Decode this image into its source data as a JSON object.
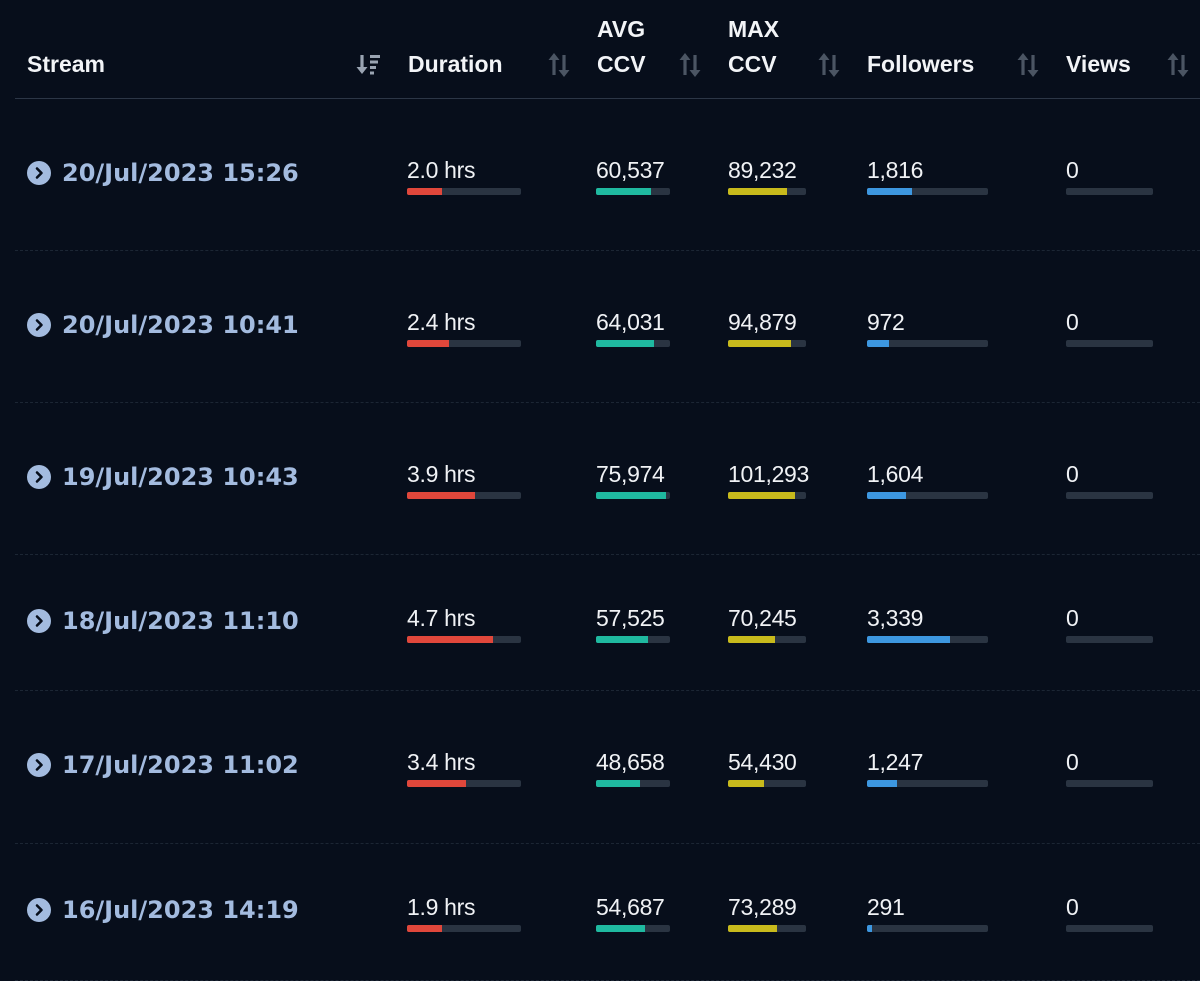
{
  "columns": [
    {
      "label": "Stream",
      "sort_icon": "sort-desc-active-icon"
    },
    {
      "label": "Duration",
      "sort_icon": "sort-icon"
    },
    {
      "label": "AVG\nCCV",
      "sort_icon": "sort-icon"
    },
    {
      "label": "MAX\nCCV",
      "sort_icon": "sort-icon"
    },
    {
      "label": "Followers",
      "sort_icon": "sort-icon"
    },
    {
      "label": "Views",
      "sort_icon": "sort-icon"
    }
  ],
  "colors": {
    "duration": "#e0473b",
    "avg_ccv": "#1fb9a0",
    "max_ccv": "#c8ba1c",
    "followers": "#3d97e0",
    "link": "#a3bbdf",
    "bar_track": "#2a3442"
  },
  "rows": [
    {
      "stream": "20/Jul/2023 15:26",
      "duration": "2.0 hrs",
      "duration_fill": 0.31,
      "avg_ccv": "60,537",
      "avg_ccv_fill": 0.74,
      "max_ccv": "89,232",
      "max_ccv_fill": 0.76,
      "followers": "1,816",
      "followers_fill": 0.37,
      "views": "0",
      "views_fill": 0
    },
    {
      "stream": "20/Jul/2023 10:41",
      "duration": "2.4 hrs",
      "duration_fill": 0.37,
      "avg_ccv": "64,031",
      "avg_ccv_fill": 0.78,
      "max_ccv": "94,879",
      "max_ccv_fill": 0.81,
      "followers": "972",
      "followers_fill": 0.18,
      "views": "0",
      "views_fill": 0
    },
    {
      "stream": "19/Jul/2023 10:43",
      "duration": "3.9 hrs",
      "duration_fill": 0.6,
      "avg_ccv": "75,974",
      "avg_ccv_fill": 0.94,
      "max_ccv": "101,293",
      "max_ccv_fill": 0.86,
      "followers": "1,604",
      "followers_fill": 0.32,
      "views": "0",
      "views_fill": 0
    },
    {
      "stream": "18/Jul/2023 11:10",
      "duration": "4.7 hrs",
      "duration_fill": 0.75,
      "avg_ccv": "57,525",
      "avg_ccv_fill": 0.7,
      "max_ccv": "70,245",
      "max_ccv_fill": 0.6,
      "followers": "3,339",
      "followers_fill": 0.69,
      "views": "0",
      "views_fill": 0
    },
    {
      "stream": "17/Jul/2023 11:02",
      "duration": "3.4 hrs",
      "duration_fill": 0.52,
      "avg_ccv": "48,658",
      "avg_ccv_fill": 0.59,
      "max_ccv": "54,430",
      "max_ccv_fill": 0.46,
      "followers": "1,247",
      "followers_fill": 0.25,
      "views": "0",
      "views_fill": 0
    },
    {
      "stream": "16/Jul/2023 14:19",
      "duration": "1.9 hrs",
      "duration_fill": 0.31,
      "avg_ccv": "54,687",
      "avg_ccv_fill": 0.66,
      "max_ccv": "73,289",
      "max_ccv_fill": 0.63,
      "followers": "291",
      "followers_fill": 0.04,
      "views": "0",
      "views_fill": 0
    }
  ]
}
